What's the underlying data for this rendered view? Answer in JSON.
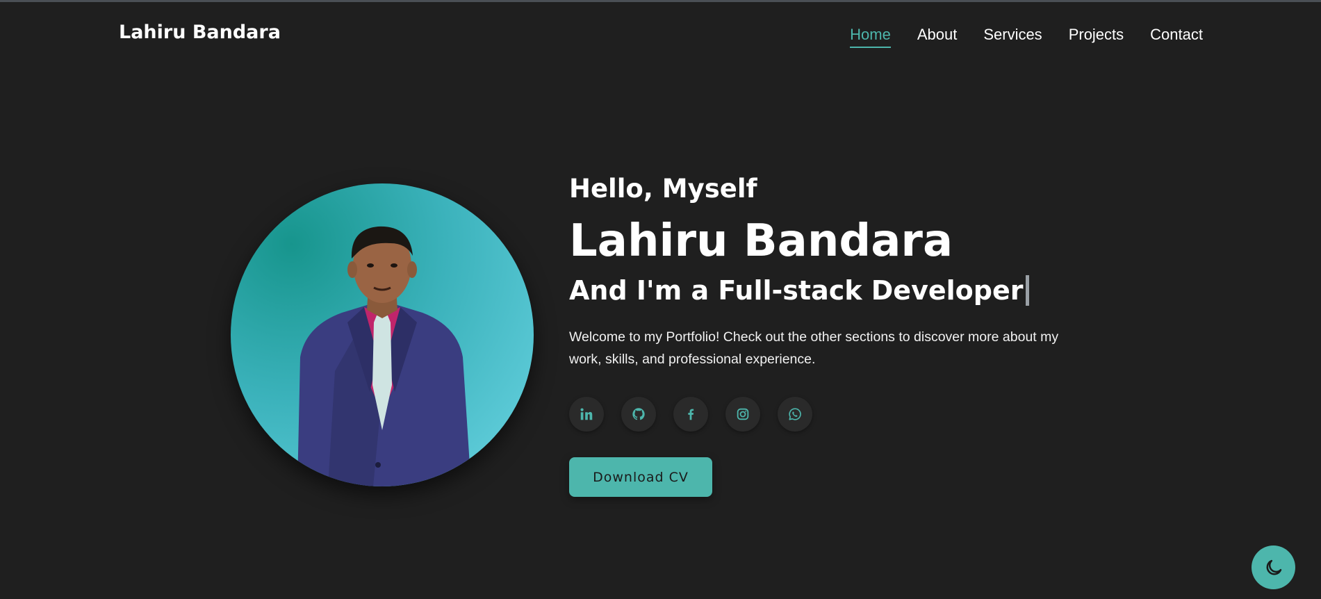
{
  "header": {
    "brand": "Lahiru Bandara",
    "nav": [
      {
        "label": "Home",
        "active": true
      },
      {
        "label": "About",
        "active": false
      },
      {
        "label": "Services",
        "active": false
      },
      {
        "label": "Projects",
        "active": false
      },
      {
        "label": "Contact",
        "active": false
      }
    ]
  },
  "hero": {
    "greeting": "Hello, Myself",
    "name": "Lahiru Bandara",
    "role": "And I'm a Full-stack Developer",
    "intro": "Welcome to my Portfolio! Check out the other sections to discover more about my work, skills, and professional experience.",
    "socials": [
      {
        "icon": "linkedin-icon"
      },
      {
        "icon": "github-icon"
      },
      {
        "icon": "facebook-icon"
      },
      {
        "icon": "instagram-icon"
      },
      {
        "icon": "whatsapp-icon"
      }
    ],
    "cv_button": "Download CV"
  },
  "theme_toggle": {
    "icon": "moon-icon"
  },
  "colors": {
    "background": "#1f1f1f",
    "accent": "#4db6ac",
    "text": "#ffffff",
    "social_bg": "#2a2a2a"
  }
}
